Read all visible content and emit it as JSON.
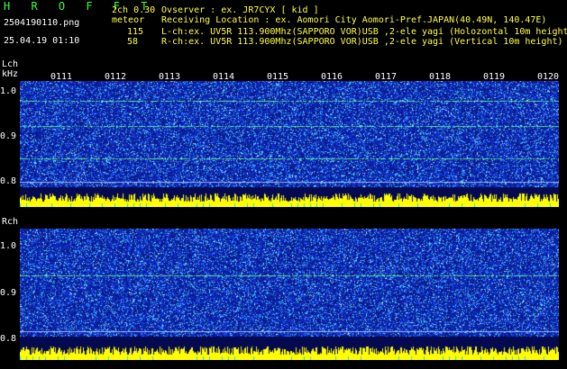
{
  "header": {
    "app_name": "H R O F F T",
    "filename": "2504190110.png",
    "datetime": "25.04.19 01:10",
    "version": "2ch 0.30",
    "meteor_label": "meteor",
    "count_l": "115",
    "count_r": "58",
    "observer": "Ovserver              : ex. JR7CYX [ kid ]",
    "location": "Receiving Location : ex. Aomori City Aomori-Pref.JAPAN(40.49N, 140.47E)",
    "lch_info": "L-ch:ex. UV5R 113.900Mhz(SAPPORO VOR)USB ,2-ele yagi (Holozontal 10m height)",
    "rch_info": "R-ch:ex. UV5R 113.900Mhz(SAPPORO VOR)USB ,2-ele yagi (Vertical 10m height)"
  },
  "left_channel": {
    "label": "Lch",
    "unit": "kHz",
    "y_ticks": [
      "1.0",
      "0.9",
      "0.8"
    ],
    "time_ticks": [
      "0111",
      "0112",
      "0113",
      "0114",
      "0115",
      "0116",
      "0117",
      "0118",
      "0119",
      "0120"
    ]
  },
  "right_channel": {
    "label": "Rch",
    "y_ticks": [
      "1.0",
      "0.9",
      "0.8"
    ],
    "time_ticks": [
      "0111",
      "0112",
      "0113",
      "0114",
      "0115",
      "0116",
      "0117",
      "0118",
      "0119",
      "0120"
    ]
  },
  "colors": {
    "background": "#000000",
    "spectrum_base": "#0a1a8c",
    "signal_line": "#6dff9a",
    "header_green": "#3cff3c",
    "header_yellow": "#ffff4a",
    "histogram": "#ffff00"
  }
}
